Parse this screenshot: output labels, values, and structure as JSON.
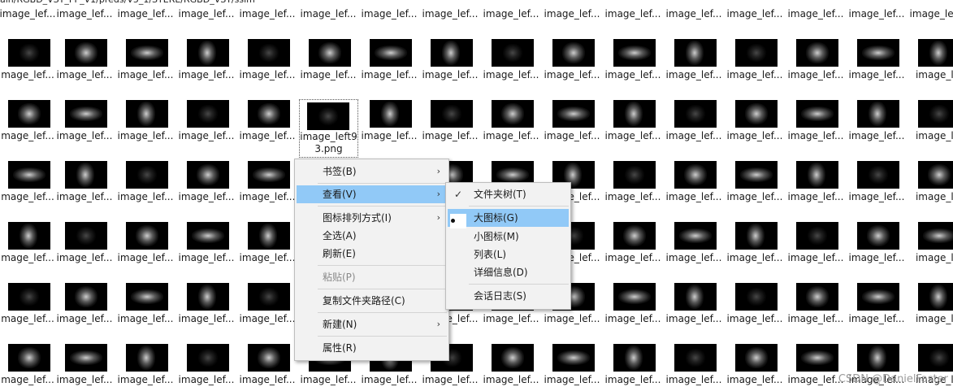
{
  "address_bar": {
    "path_text": "ain/RGBD_VST_PP_V1/preds/V5_1/STERE/RGBD_VST/ssim"
  },
  "file_grid": {
    "item_label": "image_lef...",
    "selected_item_label": "image_left93.png",
    "row_top_label": "image_lef...",
    "edge_label_left": "mage_lef...",
    "edge_label_right": "image_le"
  },
  "context_menu": {
    "items": [
      {
        "label": "书签(B)",
        "submenu": true,
        "disabled": false
      },
      {
        "label": "查看(V)",
        "submenu": true,
        "disabled": false,
        "highlighted": true
      },
      {
        "label": "图标排列方式(I)",
        "submenu": true,
        "disabled": false
      },
      {
        "label": "全选(A)",
        "submenu": false,
        "disabled": false
      },
      {
        "label": "刷新(E)",
        "submenu": false,
        "disabled": false
      },
      {
        "label": "粘贴(P)",
        "submenu": false,
        "disabled": true
      },
      {
        "label": "复制文件夹路径(C)",
        "submenu": false,
        "disabled": false
      },
      {
        "label": "新建(N)",
        "submenu": true,
        "disabled": false
      },
      {
        "label": "属性(R)",
        "submenu": false,
        "disabled": false
      }
    ],
    "arrow_glyph": "›"
  },
  "view_submenu": {
    "items": [
      {
        "label": "文件夹树(T)",
        "checked": true
      },
      {
        "label": "大图标(G)",
        "selected_radio": true,
        "highlighted": true
      },
      {
        "label": "小图标(M)"
      },
      {
        "label": "列表(L)"
      },
      {
        "label": "详细信息(D)"
      },
      {
        "label": "会话日志(S)"
      }
    ],
    "check_glyph": "✓"
  },
  "watermark": {
    "text": "CSDN @DanielFaster"
  }
}
